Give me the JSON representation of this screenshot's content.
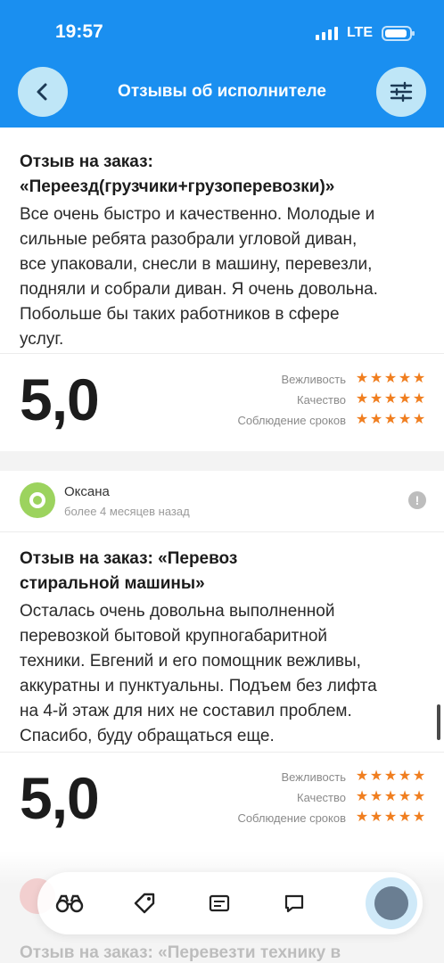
{
  "status_bar": {
    "time": "19:57",
    "network": "LTE"
  },
  "header": {
    "title": "Отзывы об исполнителе"
  },
  "reviews": [
    {
      "title_line1": "Отзыв на заказ:",
      "title_line2": "«Переезд(грузчики+грузоперевозки)»",
      "text_lines": [
        "Все очень быстро и качественно. Молодые и",
        "сильные ребята разобрали угловой диван,",
        "все упаковали, снесли в машину, перевезли,",
        "подняли и собрали диван. Я очень довольна.",
        "Побольше бы таких работников в сфере",
        "услуг."
      ],
      "score": "5,0",
      "ratings": [
        {
          "label": "Вежливость",
          "stars": 5
        },
        {
          "label": "Качество",
          "stars": 5
        },
        {
          "label": "Соблюдение сроков",
          "stars": 5
        }
      ]
    },
    {
      "author": "Оксана",
      "date": "более 4 месяцев назад",
      "title_line1": "Отзыв на заказ: «Перевоз",
      "title_line2": "стиральной машины»",
      "text_lines": [
        "Осталась очень довольна выполненной",
        "перевозкой бытовой крупногабаритной",
        "техники. Евгений и его помощник вежливы,",
        "аккуратны и пунктуальны. Подъем без лифта",
        "на 4-й этаж для них не составил проблем.",
        "Спасибо, буду обращаться еще."
      ],
      "score": "5,0",
      "ratings": [
        {
          "label": "Вежливость",
          "stars": 5
        },
        {
          "label": "Качество",
          "stars": 5
        },
        {
          "label": "Соблюдение сроков",
          "stars": 5
        }
      ]
    }
  ],
  "partial_next_review": {
    "title": "Отзыв на заказ: «Перевезти технику в"
  },
  "colors": {
    "header": "#1a8ff0",
    "button_bg": "#bfe6f7",
    "star": "#f07e1f"
  },
  "icons": [
    "back-arrow-icon",
    "filter-sliders-icon",
    "binoculars-icon",
    "tag-icon",
    "orders-icon",
    "chat-icon",
    "profile-avatar"
  ]
}
